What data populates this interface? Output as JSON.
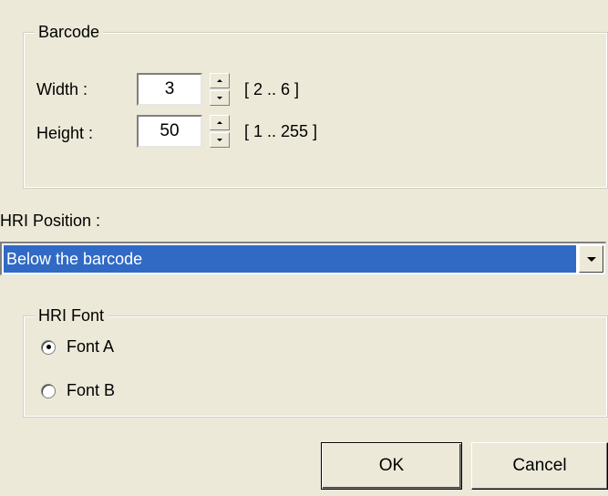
{
  "barcode": {
    "legend": "Barcode",
    "width": {
      "label": "Width :",
      "value": "3",
      "range": "[ 2 .. 6 ]"
    },
    "height": {
      "label": "Height :",
      "value": "50",
      "range": "[ 1 .. 255 ]"
    }
  },
  "hri_position": {
    "label": "HRI Position :",
    "selected": "Below the barcode"
  },
  "hri_font": {
    "legend": "HRI Font",
    "options": [
      {
        "label": "Font A",
        "checked": true
      },
      {
        "label": "Font B",
        "checked": false
      }
    ]
  },
  "buttons": {
    "ok": "OK",
    "cancel": "Cancel"
  },
  "colors": {
    "selection": "#316ac5",
    "face": "#ece9d8"
  }
}
